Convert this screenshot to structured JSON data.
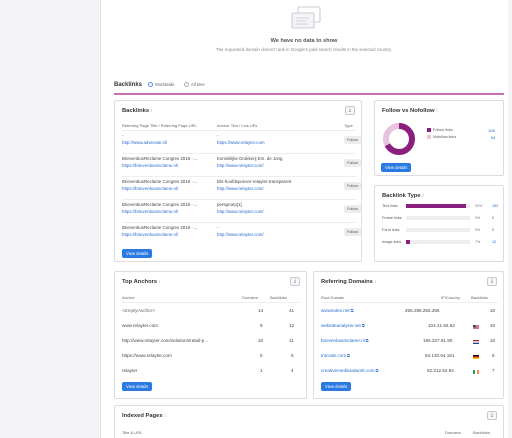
{
  "empty_state": {
    "title": "We have no data to show",
    "subtitle": "The requested domain doesn't rank in Google's paid search results in the selected country."
  },
  "backlinks_section": {
    "title": "Backlinks",
    "scope_options": [
      "Worldwide",
      "All time"
    ]
  },
  "backlinks_card": {
    "title": "Backlinks",
    "info": "i",
    "export": "⤓",
    "columns": [
      "Referring Page Title / Referring Page URL",
      "Anchor Text / Link URL",
      "Type"
    ],
    "rows": [
      {
        "title": "-",
        "url": "http://www.advevate.nl/",
        "anchor": "-",
        "link": "https://www.relayter.com",
        "type": "Follow"
      },
      {
        "title": "BrievenbusReclame Congres 2018 - ...",
        "url": "https://brievenbusreclame.nl/",
        "anchor": "Koninklijke Drukkerij Em. de Jong",
        "link": "http://www.relayter.com/",
        "type": "Follow"
      },
      {
        "title": "BrievenbusReclame Congres 2018 - ...",
        "url": "https://brievenbusreclame.nl/",
        "anchor": "bbr-hoofdsponsor-relayter-transparent",
        "link": "http://www.relayter.com/",
        "type": "Follow"
      },
      {
        "title": "BrievenbusReclame Congres 2018 - ...",
        "url": "https://brievenbusreclame.nl/",
        "anchor": "persgroep[1]",
        "link": "http://www.relayter.com/",
        "type": "Follow"
      },
      {
        "title": "BrievenbusReclame Congres 2018 - ...",
        "url": "https://brievenbusreclame.nl/",
        "anchor": "-",
        "link": "http://www.relayter.com/",
        "type": "Follow"
      }
    ],
    "view_details": "View details"
  },
  "follow_card": {
    "title": "Follow vs Nofollow",
    "info": "i",
    "legend": [
      {
        "label": "Follow links",
        "value": "108",
        "color": "#8a1f7d",
        "fraction": 0.67
      },
      {
        "label": "Nofollow links",
        "value": "54",
        "color": "#e7c3e0",
        "fraction": 0.33
      }
    ],
    "view_details": "View details"
  },
  "link_type_card": {
    "title": "Backlink Type",
    "info": "i",
    "rows": [
      {
        "label": "Text links",
        "pct": "93%",
        "count": "150",
        "fraction": 0.93
      },
      {
        "label": "Frame links",
        "pct": "0%",
        "count": "0",
        "fraction": 0
      },
      {
        "label": "Form links",
        "pct": "0%",
        "count": "0",
        "fraction": 0
      },
      {
        "label": "Image links",
        "pct": "7%",
        "count": "12",
        "fraction": 0.07
      }
    ]
  },
  "anchors_card": {
    "title": "Top Anchors",
    "info": "i",
    "export": "⤓",
    "columns": [
      "Anchor",
      "Domains",
      "Backlinks"
    ],
    "rows": [
      {
        "anchor": "<EmptyAnchor>",
        "domains": "14",
        "backlinks": "41"
      },
      {
        "anchor": "www.relayter.com",
        "domains": "9",
        "backlinks": "12"
      },
      {
        "anchor": "http://www.relayter.com/solutions/retail-p...",
        "domains": "10",
        "backlinks": "11"
      },
      {
        "anchor": "https://www.relayter.com",
        "domains": "5",
        "backlinks": "5"
      },
      {
        "anchor": "relayter",
        "domains": "1",
        "backlinks": "4"
      }
    ],
    "view_details": "View details"
  },
  "domains_card": {
    "title": "Referring Domains",
    "info": "i",
    "export": "⤓",
    "columns": [
      "Root Domain",
      "IP/Country",
      "Backlinks"
    ],
    "rows": [
      {
        "domain": "wwwindex.net",
        "ip": "255.255.255.255",
        "backlinks": "10",
        "flag": "none"
      },
      {
        "domain": "websiteanalysis.net",
        "ip": "104.21.65.52",
        "backlinks": "10",
        "flag": "us"
      },
      {
        "domain": "brievenbusreclame.nl",
        "ip": "185.227.81.90",
        "backlinks": "10",
        "flag": "nl"
      },
      {
        "domain": "tntcode.com",
        "ip": "94.130.64.161",
        "backlinks": "8",
        "flag": "de"
      },
      {
        "domain": "creativemediaratwork.com",
        "ip": "52.212.52.84",
        "backlinks": "7",
        "flag": "ie"
      }
    ],
    "view_details": "View details"
  },
  "indexed_card": {
    "title": "Indexed Pages",
    "info": "i",
    "export": "⤓",
    "columns": [
      "Title & URL",
      "Domains",
      "Backlinks"
    ]
  }
}
